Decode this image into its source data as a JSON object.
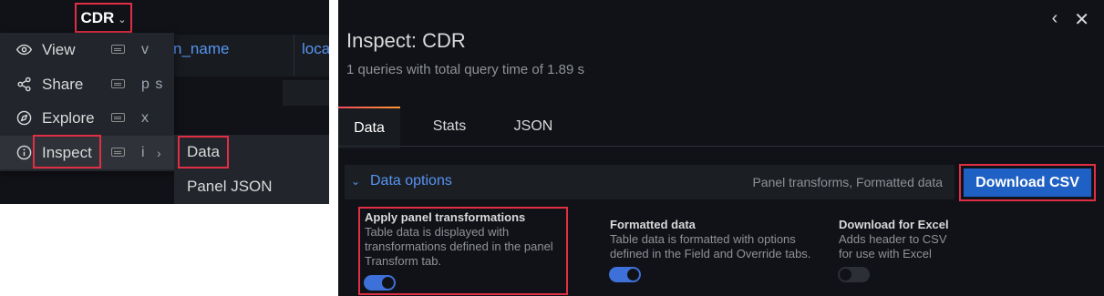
{
  "left": {
    "panel_title": "CDR",
    "bg_columns": [
      "n_name",
      "loca"
    ],
    "menu": [
      {
        "label": "View",
        "shortcut": "v",
        "icon": "eye-icon"
      },
      {
        "label": "Share",
        "shortcut": "p s",
        "icon": "share-icon"
      },
      {
        "label": "Explore",
        "shortcut": "x",
        "icon": "compass-icon"
      },
      {
        "label": "Inspect",
        "shortcut": "i",
        "icon": "info-circle-icon"
      }
    ],
    "submenu": [
      "Data",
      "Panel JSON"
    ]
  },
  "inspect": {
    "title": "Inspect: CDR",
    "subtitle": "1 queries with total query time of 1.89 s",
    "tabs": [
      "Data",
      "Stats",
      "JSON"
    ],
    "active_tab": "Data",
    "options_label": "Data options",
    "options_summary": "Panel transforms, Formatted data",
    "download_button": "Download CSV",
    "options": [
      {
        "title": "Apply panel transformations",
        "desc": [
          "Table data is displayed with",
          "transformations defined in the panel",
          "Transform tab."
        ],
        "enabled": true
      },
      {
        "title": "Formatted data",
        "desc": [
          "Table data is formatted with options",
          "defined in the Field and Override tabs."
        ],
        "enabled": true
      },
      {
        "title": "Download for Excel",
        "desc": [
          "Adds header to CSV",
          "for use with Excel"
        ],
        "enabled": false
      }
    ]
  },
  "colors": {
    "accent": "#5794f2",
    "primary_button": "#1f60c4",
    "highlight_border": "#e02f44",
    "switch_on": "#3d71d9"
  }
}
